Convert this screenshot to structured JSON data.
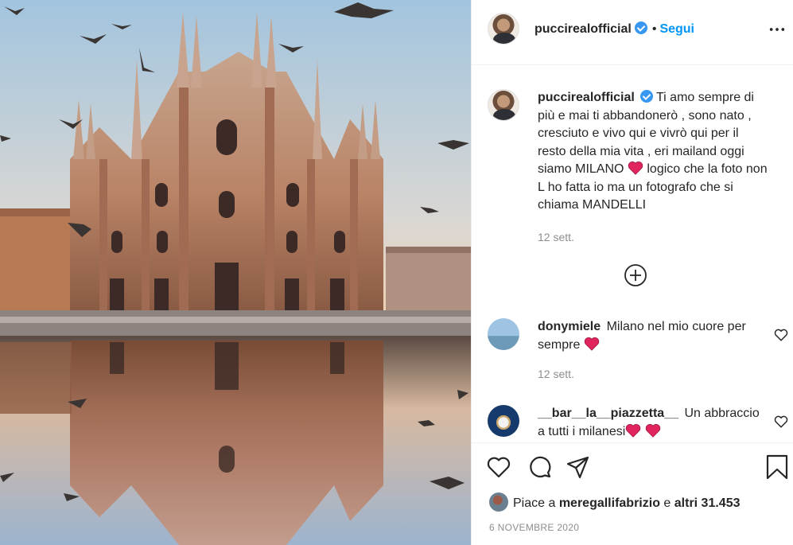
{
  "post": {
    "username": "puccirealofficial",
    "follow_label": "Segui",
    "separator": "•"
  },
  "caption": {
    "username": "puccirealofficial",
    "text_before_heart": "Ti amo sempre di più e mai ti abbandonerò , sono nato , cresciuto e vivo qui e vivrò qui per il resto della mia vita , eri mailand oggi siamo MILANO",
    "text_after_heart": " logico che la foto non L ho fatta io ma un fotografo che si chiama MANDELLI",
    "time": "12 sett."
  },
  "comments": [
    {
      "username": "donymiele",
      "text": "Milano nel mio cuore per sempre",
      "time": "12 sett."
    },
    {
      "username": "__bar__la__piazzetta__",
      "text": "Un abbraccio a tutti i milanesi"
    }
  ],
  "likes": {
    "prefix": "Piace a ",
    "user": "meregallifabrizio",
    "middle": " e ",
    "others": "altri 31.453"
  },
  "date": "6 NOVEMBRE 2020",
  "icons": {
    "more": "more-horizontal-icon",
    "expand": "plus-circle-icon",
    "like": "heart-outline-icon",
    "comment": "comment-bubble-icon",
    "share": "paper-plane-icon",
    "save": "bookmark-icon"
  },
  "colors": {
    "accent": "#0095f6",
    "verified": "#3897f0",
    "heart_emoji": "#e0245e",
    "muted_text": "#8e8e8e"
  }
}
